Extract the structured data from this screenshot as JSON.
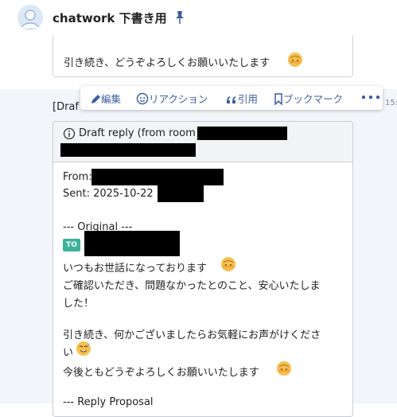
{
  "header": {
    "room_title": "chatwork 下書き用"
  },
  "messages": {
    "prev_line": "引き続き、どうぞよろしくお願いいたします"
  },
  "toolbar": {
    "edit_label": "編集",
    "reaction_label": "リアクション",
    "quote_label": "引用",
    "bookmark_label": "ブックマーク",
    "more_label": "•••"
  },
  "draft": {
    "left_label": "[Draf",
    "time_fragment": "15:",
    "header_text": "Draft reply (from room",
    "from_label": "From:",
    "sent_label": "Sent: 2025-10-22",
    "original_label": "--- Original ---",
    "to_badge": "TO",
    "body_lines": [
      "いつもお世話になっております",
      "ご確認いただき、問題なかったとのこと、安心いたしま",
      "した！",
      "引き続き、何かございましたらお気軽にお声がけくださ",
      "い",
      "今後ともどうぞよろしくお願いいたします"
    ],
    "reply_proposal_label": "--- Reply Proposal"
  }
}
